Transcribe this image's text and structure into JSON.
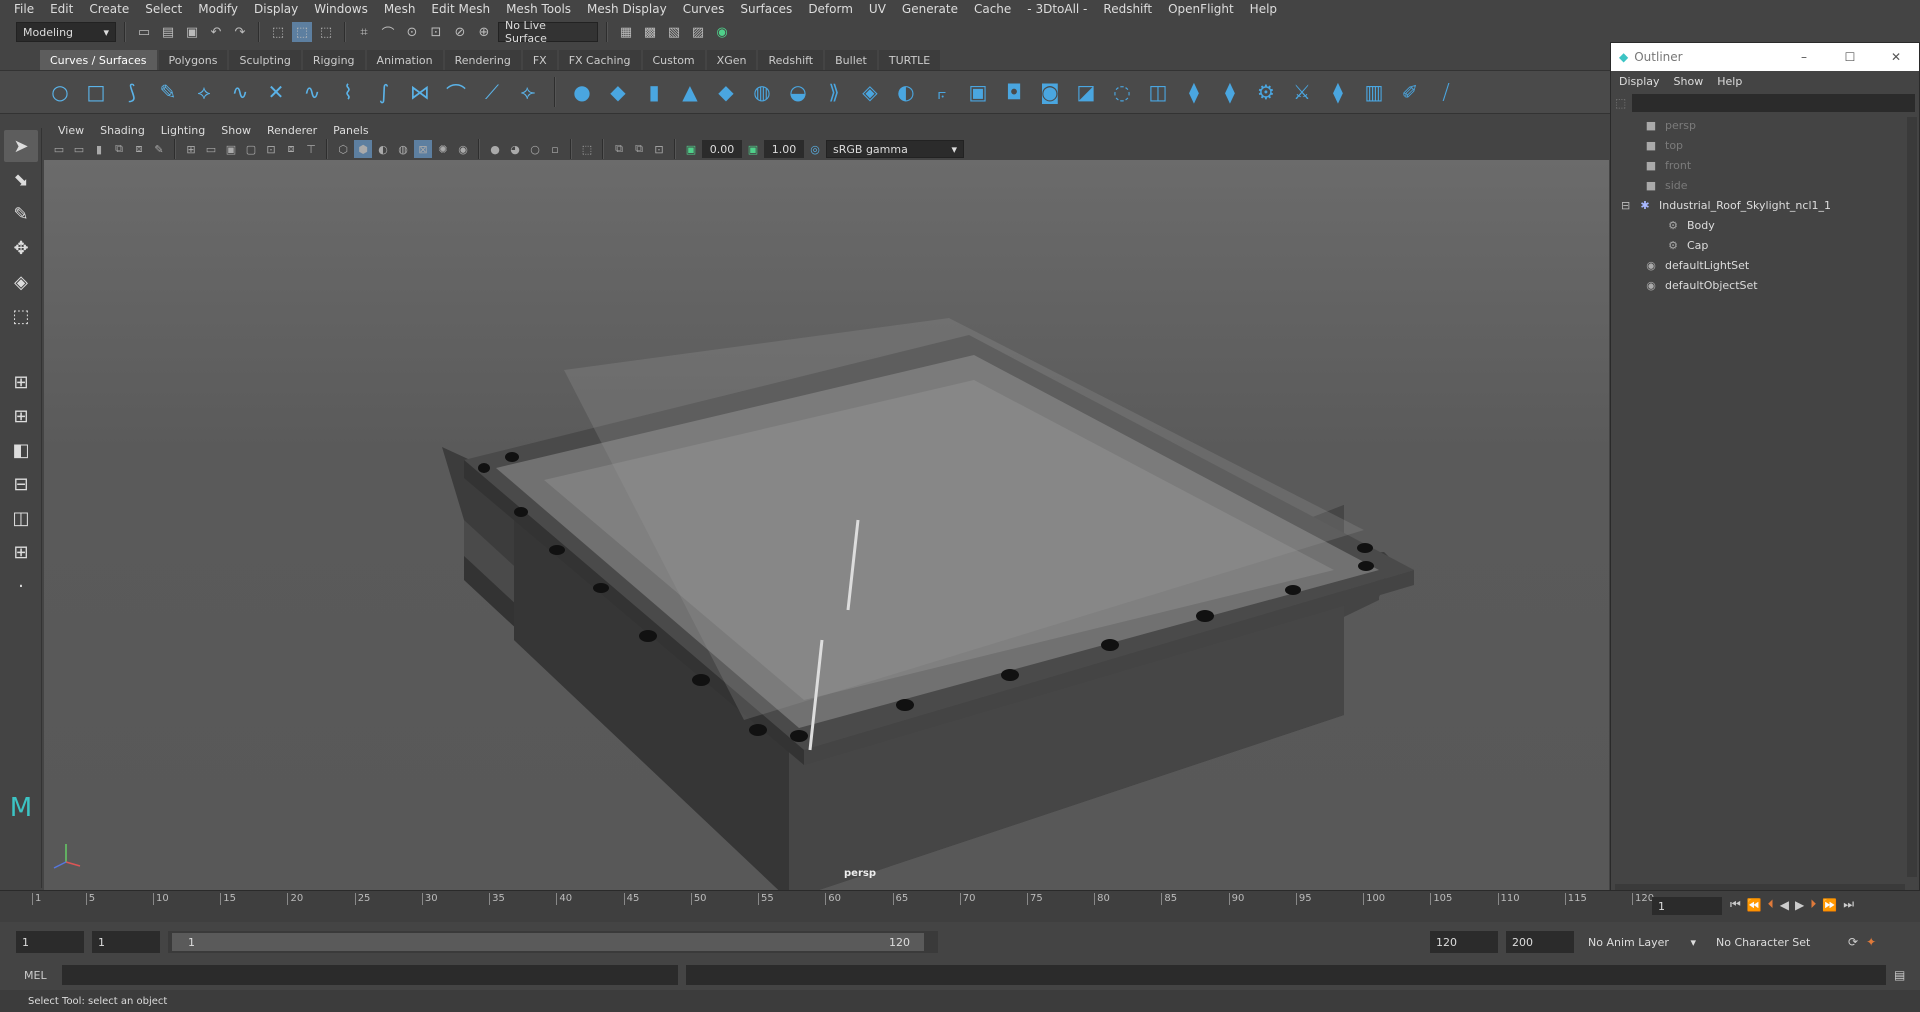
{
  "menubar": [
    "File",
    "Edit",
    "Create",
    "Select",
    "Modify",
    "Display",
    "Windows",
    "Mesh",
    "Edit Mesh",
    "Mesh Tools",
    "Mesh Display",
    "Curves",
    "Surfaces",
    "Deform",
    "UV",
    "Generate",
    "Cache",
    "- 3DtoAll -",
    "Redshift",
    "OpenFlight",
    "Help"
  ],
  "status": {
    "mode": "Modeling",
    "live_surface": "No Live Surface"
  },
  "shelf_tabs": [
    "Curves / Surfaces",
    "Polygons",
    "Sculpting",
    "Rigging",
    "Animation",
    "Rendering",
    "FX",
    "FX Caching",
    "Custom",
    "XGen",
    "Redshift",
    "Bullet",
    "TURTLE"
  ],
  "panel_menu": [
    "View",
    "Shading",
    "Lighting",
    "Show",
    "Renderer",
    "Panels"
  ],
  "panel_toolbar": {
    "exposure": "0.00",
    "gamma": "1.00",
    "color_space": "sRGB gamma"
  },
  "viewport": {
    "camera_label": "persp"
  },
  "outliner": {
    "title": "Outliner",
    "menu": [
      "Display",
      "Show",
      "Help"
    ],
    "items": [
      {
        "label": "persp",
        "icon": "camera-icon",
        "indent": 1,
        "dim": true
      },
      {
        "label": "top",
        "icon": "camera-icon",
        "indent": 1,
        "dim": true
      },
      {
        "label": "front",
        "icon": "camera-icon",
        "indent": 1,
        "dim": true
      },
      {
        "label": "side",
        "icon": "camera-icon",
        "indent": 1,
        "dim": true
      },
      {
        "label": "Industrial_Roof_Skylight_ncl1_1",
        "icon": "group-icon",
        "indent": 1,
        "dim": false,
        "expanded": true
      },
      {
        "label": "Body",
        "icon": "mesh-icon",
        "indent": 2,
        "dim": false
      },
      {
        "label": "Cap",
        "icon": "mesh-icon",
        "indent": 2,
        "dim": false
      },
      {
        "label": "defaultLightSet",
        "icon": "set-icon",
        "indent": 1,
        "dim": false
      },
      {
        "label": "defaultObjectSet",
        "icon": "set-icon",
        "indent": 1,
        "dim": false
      }
    ]
  },
  "timeline": {
    "ticks": [
      "1",
      "5",
      "10",
      "15",
      "20",
      "25",
      "30",
      "35",
      "40",
      "45",
      "50",
      "55",
      "60",
      "65",
      "70",
      "75",
      "80",
      "85",
      "90",
      "95",
      "100",
      "105",
      "110",
      "115",
      "120"
    ],
    "current_frame": "1"
  },
  "range": {
    "start": "1",
    "playback_start": "1",
    "slider_start": "1",
    "slider_end": "120",
    "playback_end": "120",
    "end": "200",
    "anim_layer": "No Anim Layer",
    "character_set": "No Character Set"
  },
  "cmdline": {
    "label": "MEL"
  },
  "helpline": {
    "text": "Select Tool: select an object"
  }
}
